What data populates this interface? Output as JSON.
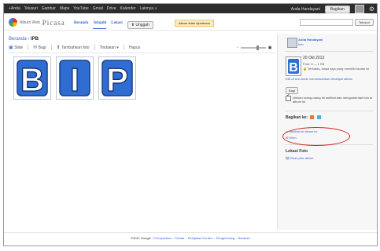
{
  "gbar": {
    "links": [
      "+Anda",
      "Telusuri",
      "Gambar",
      "Maps",
      "YouTube",
      "Gmail",
      "Drive",
      "Kalender",
      "Lainnya »"
    ],
    "user": "Anda Handayani",
    "signout": "Bagikan"
  },
  "header": {
    "logo_small": "Album Web",
    "logo_big": "Picasa",
    "tabs": [
      "Beranda",
      "Jelajahi",
      "Lokasi"
    ],
    "upload": "Unggah",
    "notice": "Album telah diperbarui",
    "search_button": "Telusuri"
  },
  "crumb": {
    "parent": "Beranda",
    "current": "IPB"
  },
  "toolbar": [
    "Slide",
    "Bagi",
    "Tambahkan foto",
    "Tindakan ▾",
    "Hapus"
  ],
  "photos": [
    "B",
    "I",
    "P"
  ],
  "right": {
    "owner_name": "Anita Handayani",
    "owner_sub": "Info",
    "date": "20 Okt 2013",
    "count": "Foto: 3 — 1 KB",
    "visibility": "Terbatas, siapa saja yang memiliki tautan ini",
    "edit_hint": "Klik di sini untuk menambahkan deskripsi album",
    "share_button": "Bagi",
    "checkbox_text": "Izinkan orang-orang ini melihat dan mengomentari foto di album ini",
    "share_to_title": "Bagikan ke:",
    "link1": "Tautkan ke album ini",
    "link2": "Kirim",
    "place_title": "Lokasi Foto",
    "place_link": "Buat peta album"
  },
  "footer": {
    "copyright": "©2011 Google",
    "links": [
      "Persyaratan",
      "Privasi",
      "Kebijakan Konten",
      "Pengembang",
      "Bantuan"
    ]
  }
}
